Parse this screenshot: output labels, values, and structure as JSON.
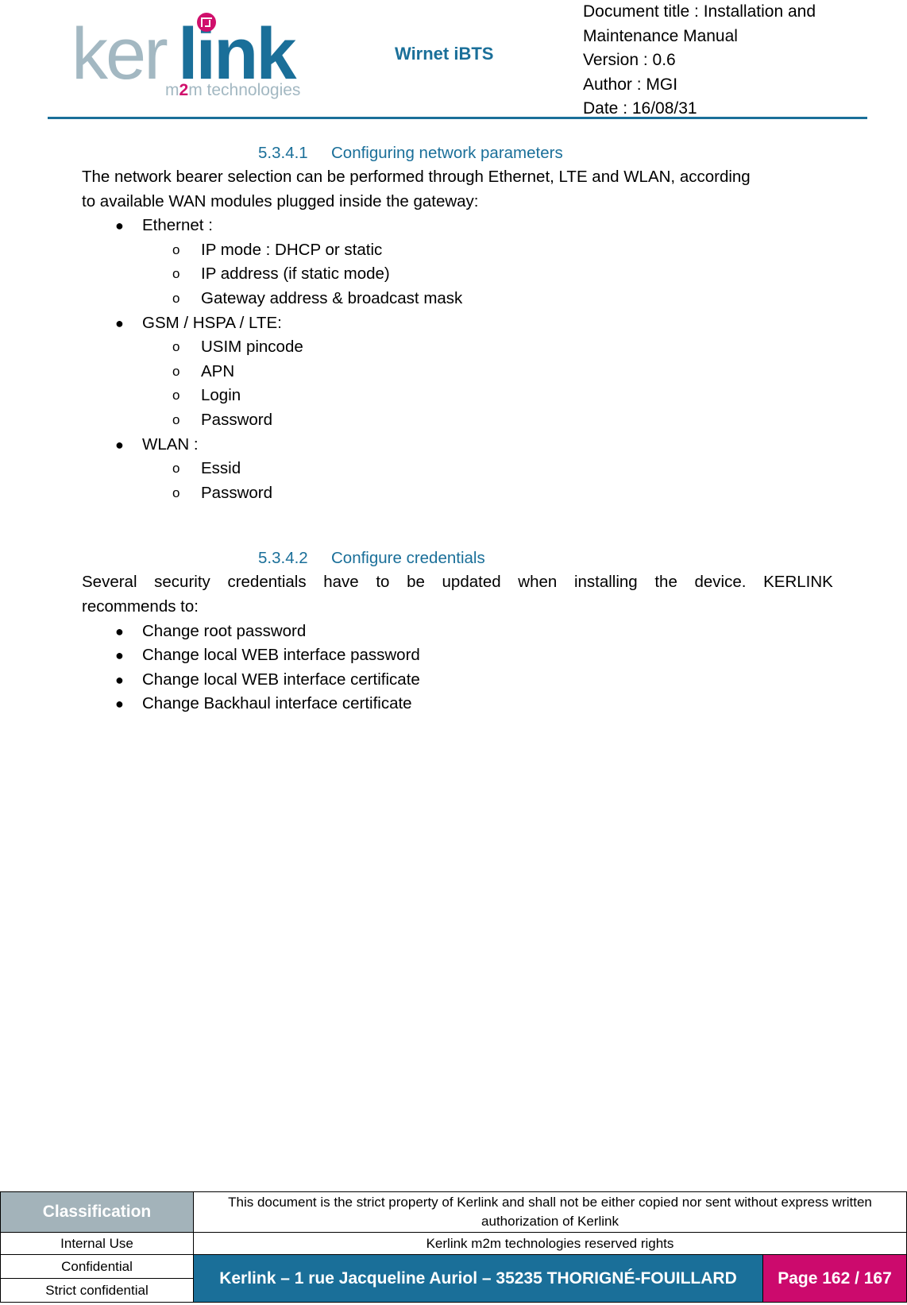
{
  "header": {
    "logo": {
      "part1": "ker",
      "part2": "link",
      "tagline_pre": "m",
      "tagline_two": "2",
      "tagline_post": "m technologies"
    },
    "product": "Wirnet iBTS",
    "doc_info": [
      "Document title : Installation and",
      "Maintenance Manual",
      "Version : 0.6",
      "Author : MGI",
      "Date : 16/08/31"
    ]
  },
  "section1": {
    "number": "5.3.4.1",
    "title": "Configuring network parameters",
    "intro_line1": "The network bearer selection can be performed through Ethernet, LTE and WLAN, according",
    "intro_line2": "to available WAN modules plugged inside the gateway:",
    "items": [
      {
        "label": "Ethernet :",
        "subitems": [
          "IP mode : DHCP or static",
          "IP address (if static mode)",
          "Gateway address & broadcast mask"
        ]
      },
      {
        "label": "GSM / HSPA / LTE:",
        "subitems": [
          "USIM pincode",
          "APN",
          "Login",
          "Password"
        ]
      },
      {
        "label": "WLAN :",
        "subitems": [
          "Essid",
          "Password"
        ]
      }
    ]
  },
  "section2": {
    "number": "5.3.4.2",
    "title": "Configure credentials",
    "intro_words": [
      "Several",
      "security",
      "credentials",
      "have",
      "to",
      "be",
      "updated",
      "when",
      "installing",
      "the",
      "device.",
      "KERLINK"
    ],
    "intro_line2": "recommends to:",
    "items": [
      "Change root password",
      "Change local WEB interface password",
      "Change local WEB interface certificate",
      "Change Backhaul interface certificate"
    ]
  },
  "bullets": {
    "level1": "●",
    "level2": "o"
  },
  "footer": {
    "classification_label": "Classification",
    "notice": "This document is the strict property of Kerlink and shall not be either copied nor sent without express written authorization of Kerlink",
    "levels": [
      "Internal Use",
      "Confidential",
      "Strict confidential"
    ],
    "rights": "Kerlink m2m technologies reserved rights",
    "address": "Kerlink – 1 rue Jacqueline Auriol – 35235 THORIGNÉ-FOUILLARD",
    "page": "Page 162 / 167"
  },
  "colors": {
    "brand_blue": "#1a6f99",
    "brand_magenta": "#cc0a6d",
    "logo_grey": "#a3b8c2",
    "classification_grey": "#a3b3ba"
  }
}
